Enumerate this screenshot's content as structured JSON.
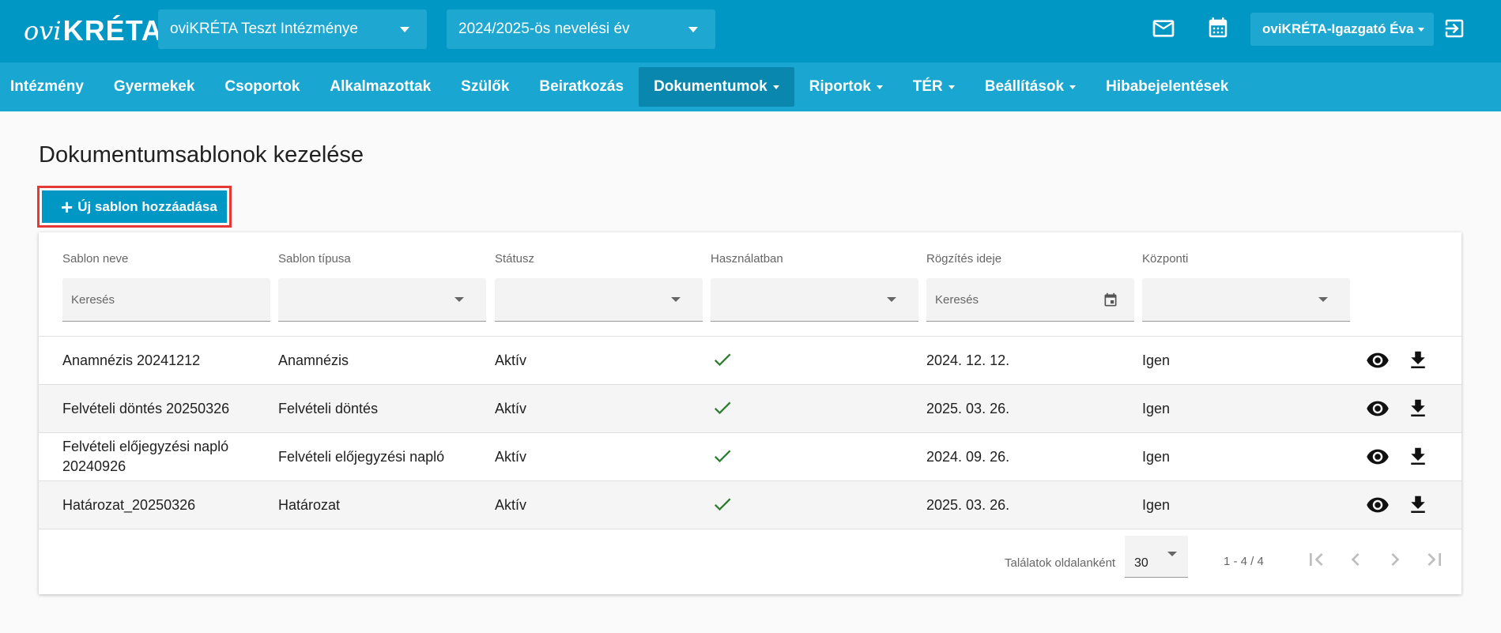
{
  "header": {
    "logo_text_1": "ovi",
    "logo_text_2": "KRÉTA",
    "institution": "oviKRÉTA Teszt Intézménye",
    "school_year": "2024/2025-ös nevelési év",
    "user": "oviKRÉTA-Igazgató Éva"
  },
  "nav": {
    "items": [
      {
        "label": "Intézmény",
        "dropdown": false
      },
      {
        "label": "Gyermekek",
        "dropdown": false
      },
      {
        "label": "Csoportok",
        "dropdown": false
      },
      {
        "label": "Alkalmazottak",
        "dropdown": false
      },
      {
        "label": "Szülők",
        "dropdown": false
      },
      {
        "label": "Beiratkozás",
        "dropdown": false
      },
      {
        "label": "Dokumentumok",
        "dropdown": true,
        "active": true
      },
      {
        "label": "Riportok",
        "dropdown": true
      },
      {
        "label": "TÉR",
        "dropdown": true
      },
      {
        "label": "Beállítások",
        "dropdown": true
      },
      {
        "label": "Hibabejelentések",
        "dropdown": false
      }
    ]
  },
  "page": {
    "title": "Dokumentumsablonok kezelése",
    "add_button": "Új sablon hozzáadása"
  },
  "table": {
    "columns": [
      "Sablon neve",
      "Sablon típusa",
      "Státusz",
      "Használatban",
      "Rögzítés ideje",
      "Központi"
    ],
    "filters": {
      "name_placeholder": "Keresés",
      "date_placeholder": "Keresés"
    },
    "rows": [
      {
        "name": "Anamnézis 20241212",
        "type": "Anamnézis",
        "status": "Aktív",
        "in_use": true,
        "date": "2024. 12. 12.",
        "central": "Igen"
      },
      {
        "name": "Felvételi döntés 20250326",
        "type": "Felvételi döntés",
        "status": "Aktív",
        "in_use": true,
        "date": "2025. 03. 26.",
        "central": "Igen"
      },
      {
        "name": "Felvételi előjegyzési napló 20240926",
        "type": "Felvételi előjegyzési napló",
        "status": "Aktív",
        "in_use": true,
        "date": "2024. 09. 26.",
        "central": "Igen"
      },
      {
        "name": "Határozat_20250326",
        "type": "Határozat",
        "status": "Aktív",
        "in_use": true,
        "date": "2025. 03. 26.",
        "central": "Igen"
      }
    ]
  },
  "pager": {
    "label": "Találatok oldalanként",
    "page_size": "30",
    "range": "1 - 4 / 4"
  },
  "colors": {
    "primary": "#0097c4",
    "nav": "#19a6d0",
    "nav_active": "#0a87ae",
    "check": "#2e7d32",
    "highlight": "#e53935"
  },
  "icons": [
    "mail-icon",
    "calendar-icon",
    "logout-icon",
    "check-icon",
    "eye-icon",
    "download-icon",
    "first-page-icon",
    "prev-page-icon",
    "next-page-icon",
    "last-page-icon"
  ]
}
